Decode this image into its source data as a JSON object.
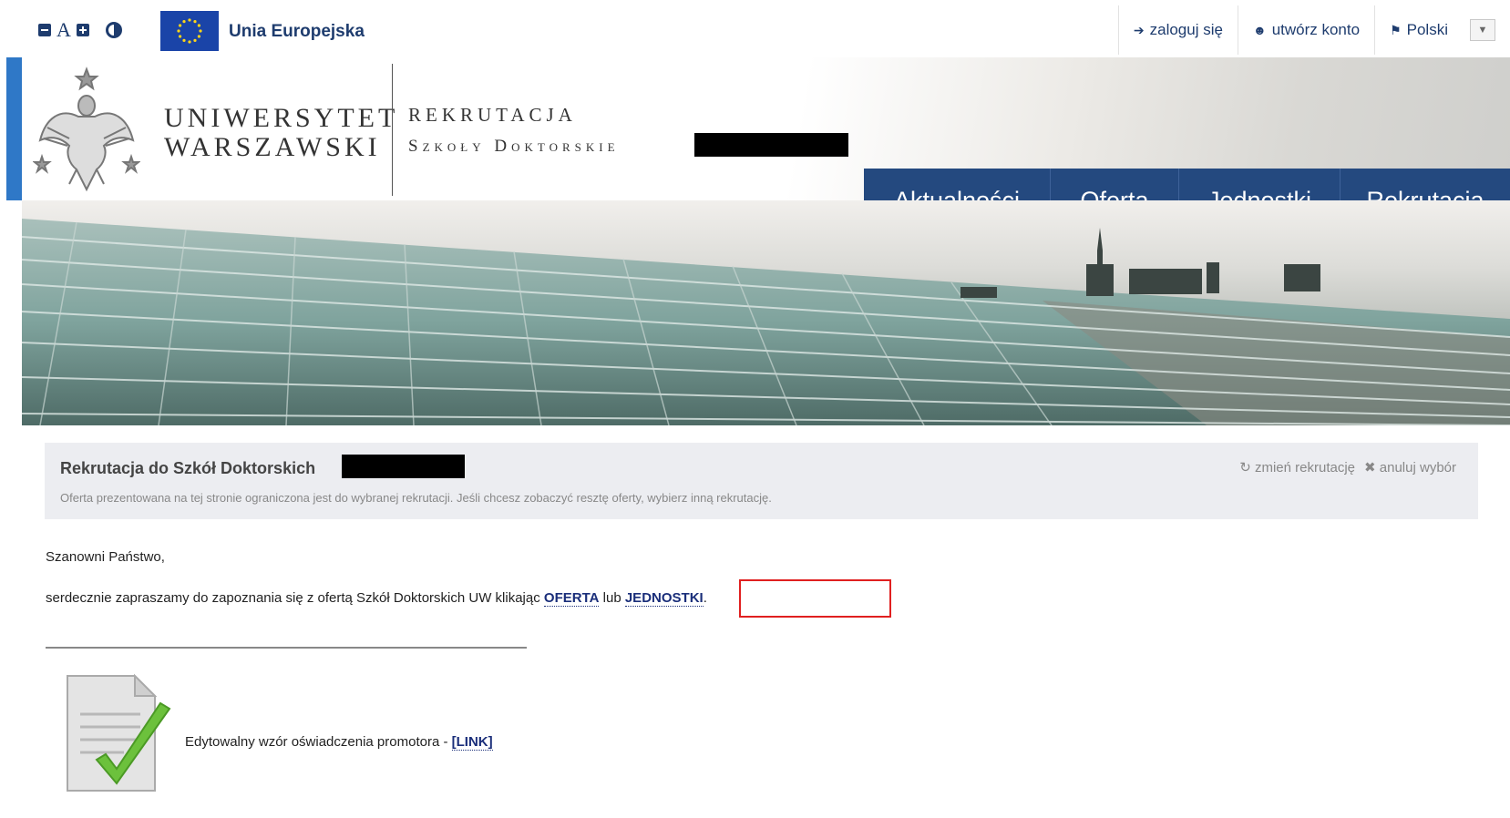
{
  "topbar": {
    "a11y_font_letter": "A",
    "eu_label": "Unia Europejska",
    "login_label": "zaloguj się",
    "create_account_label": "utwórz konto",
    "language_label": "Polski"
  },
  "header": {
    "university_line1": "UNIWERSYTET",
    "university_line2": "WARSZAWSKI",
    "section_title": "REKRUTACJA",
    "section_subtitle": "Szkoły Doktorskie"
  },
  "main_nav": {
    "items": [
      {
        "label": "Aktualności"
      },
      {
        "label": "Oferta"
      },
      {
        "label": "Jednostki"
      },
      {
        "label": "Rekrutacja"
      }
    ]
  },
  "info_box": {
    "title": "Rekrutacja do Szkół Doktorskich",
    "description": "Oferta prezentowana na tej stronie ograniczona jest do wybranej rekrutacji. Jeśli chcesz zobaczyć resztę oferty, wybierz inną rekrutację.",
    "change_label": "zmień rekrutację",
    "cancel_label": "anuluj wybór"
  },
  "content": {
    "greeting": "Szanowni Państwo,",
    "invite_prefix": "serdecznie zapraszamy do zapoznania się z ofertą Szkół Doktorskich UW klikając",
    "link_oferta": "OFERTA",
    "invite_or": "lub",
    "link_jednostki": "JEDNOSTKI",
    "invite_suffix": ".",
    "doc_text": "Edytowalny wzór oświadczenia promotora -",
    "doc_link": "[LINK]"
  },
  "colors": {
    "navy": "#24497f",
    "accent_blue": "#2f78c7",
    "link": "#1a2e7a",
    "highlight": "#e02020"
  },
  "icons": [
    "font-decrease-icon",
    "font-increase-icon",
    "contrast-icon",
    "eu-flag-icon",
    "login-icon",
    "user-plus-icon",
    "language-flag-icon",
    "chevron-down-icon",
    "refresh-icon",
    "close-icon",
    "document-check-icon",
    "university-eagle-logo"
  ]
}
